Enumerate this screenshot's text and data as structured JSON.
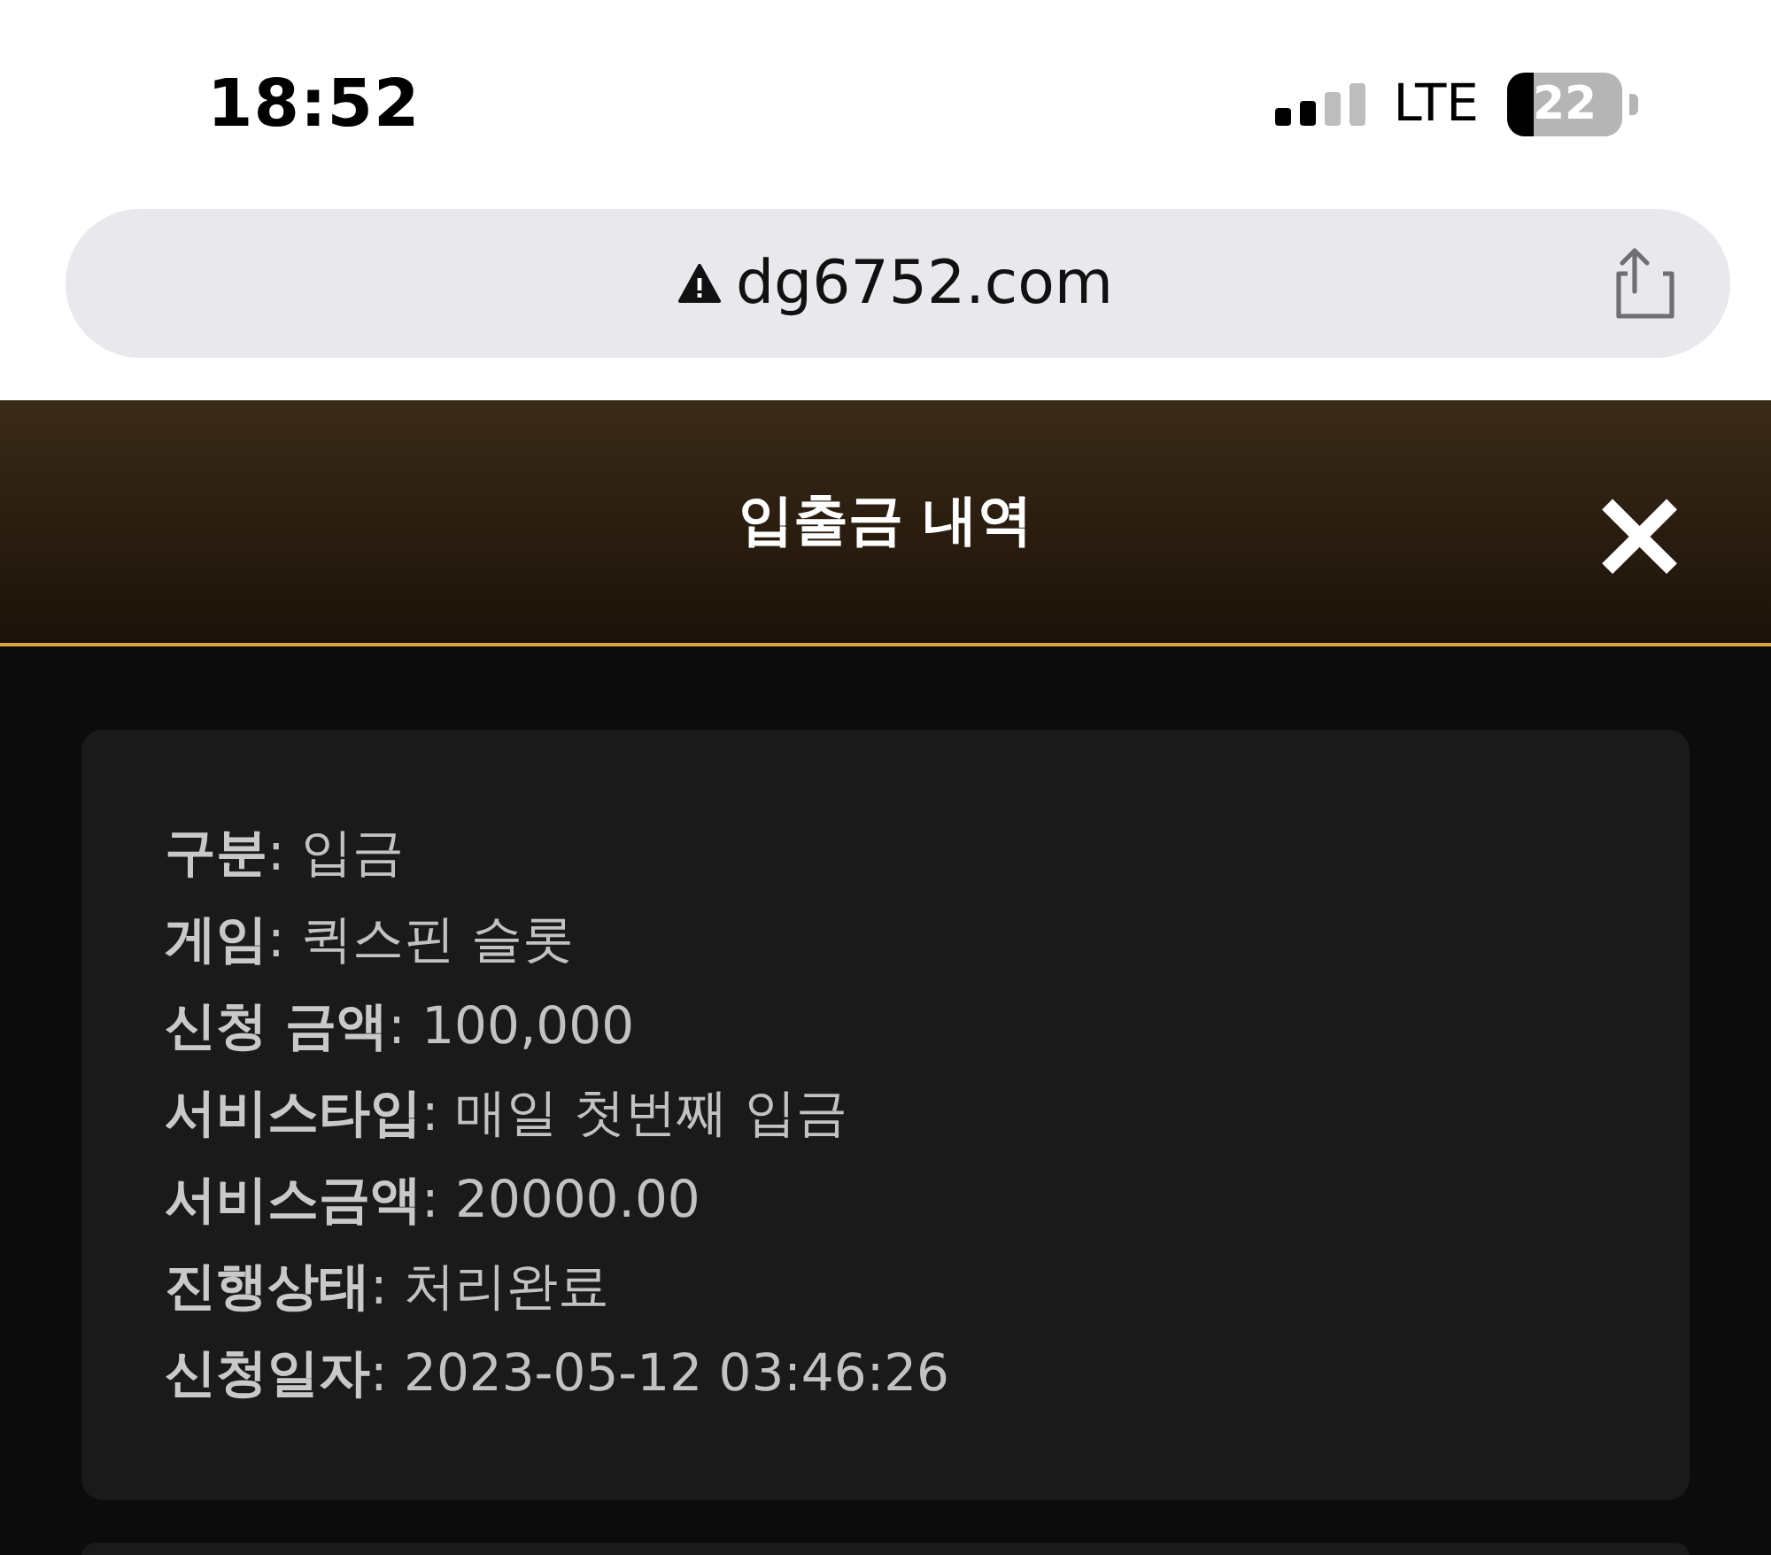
{
  "status_bar": {
    "time": "18:52",
    "network": "LTE",
    "battery": "22"
  },
  "browser": {
    "url": "dg6752.com"
  },
  "header": {
    "title": "입출금 내역",
    "close": "×"
  },
  "records": [
    {
      "lines": [
        "**구분**: 입금",
        "**게임**: 퀵스핀 슬롯",
        "**신청 금액**: 100,000",
        "**서비스타입**: 매일 첫번째 입금",
        "**서비스금액**: 20000.00",
        "**진행상태**: 처리완료",
        "**신청일자**: 2023-05-12 03:46:26"
      ]
    }
  ]
}
